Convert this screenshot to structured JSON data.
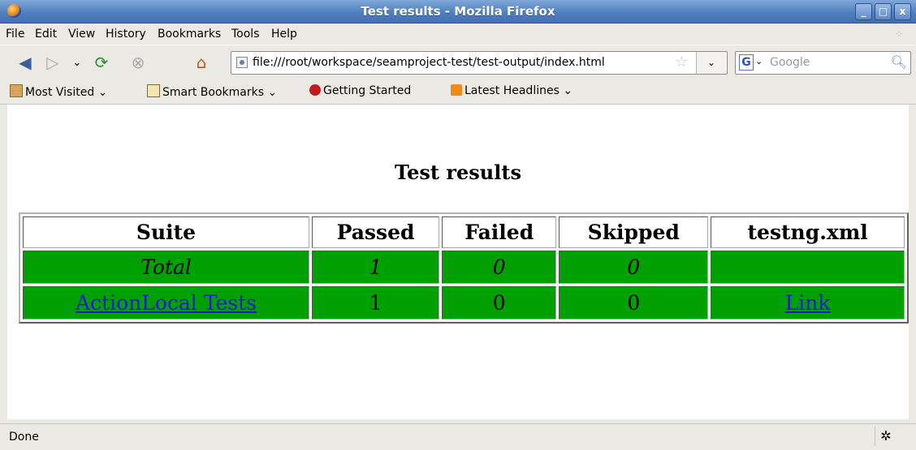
{
  "window": {
    "title": "Test results - Mozilla Firefox",
    "buttons": [
      "_",
      "□",
      "x"
    ]
  },
  "menu": [
    "File",
    "Edit",
    "View",
    "History",
    "Bookmarks",
    "Tools",
    "Help"
  ],
  "nav": {
    "url": "file:///root/workspace/seamproject-test/test-output/index.html",
    "search_placeholder": "Google",
    "search_engine_letter": "G"
  },
  "bookmarks": [
    "Most Visited ⌄",
    "Smart Bookmarks ⌄",
    "Getting Started",
    "Latest Headlines ⌄"
  ],
  "page": {
    "heading": "Test results",
    "columns": [
      "Suite",
      "Passed",
      "Failed",
      "Skipped",
      "testng.xml"
    ],
    "total_row": {
      "suite": "Total",
      "passed": "1",
      "failed": "0",
      "skipped": "0",
      "xml": ""
    },
    "rows": [
      {
        "suite": "ActionLocal Tests",
        "passed": "1",
        "failed": "0",
        "skipped": "0",
        "xml": "Link"
      }
    ],
    "row_color": "#00a000"
  },
  "status": {
    "text": "Done"
  }
}
